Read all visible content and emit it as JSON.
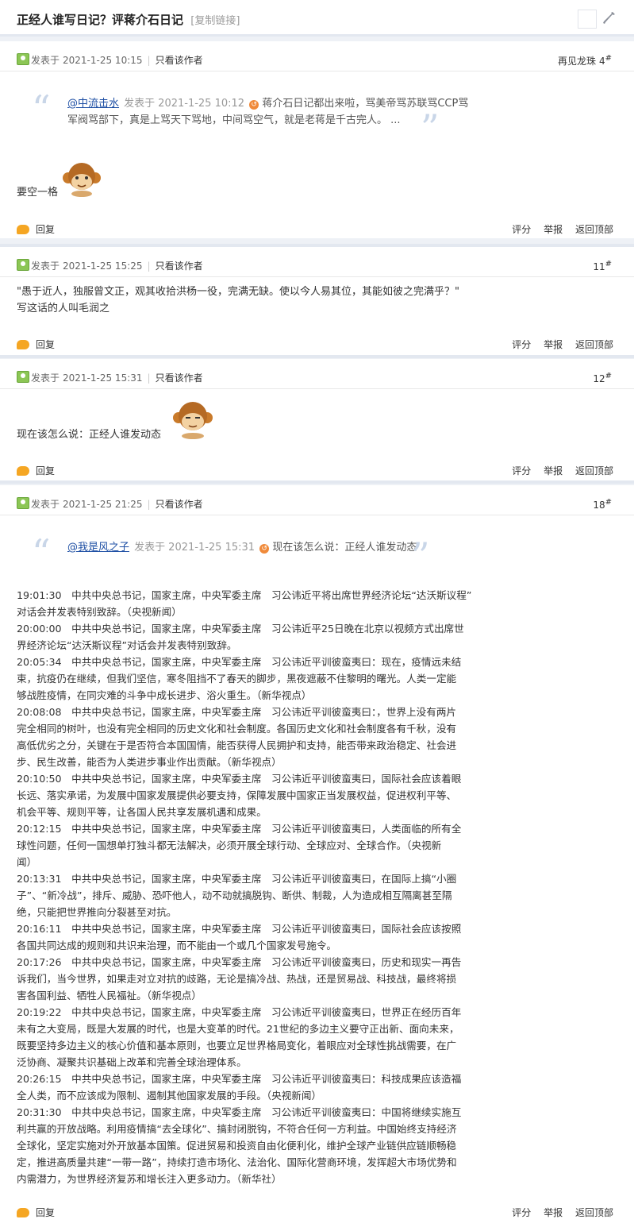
{
  "header": {
    "title": "正经人谁写日记？评蒋介石日记",
    "copy_link": "[复制链接]"
  },
  "posts": [
    {
      "posted_label": "发表于",
      "time": "2021-1-25 10:15",
      "only_author": "只看该作者",
      "nickname": "再见龙珠",
      "floor": "4",
      "floor_mark": "#",
      "quote": {
        "user": "@中流击水",
        "posted_label": "发表于",
        "time": "2021-1-25 10:12",
        "text": "蒋介石日记都出来啦，骂美帝骂苏联骂CCP骂军阀骂部下，真是上骂天下骂地，中间骂空气，就是老蒋是千古完人。 ..."
      },
      "body": "要空一格",
      "emoji": "monkey-emoji"
    },
    {
      "posted_label": "发表于",
      "time": "2021-1-25 15:25",
      "only_author": "只看该作者",
      "floor": "11",
      "floor_mark": "#",
      "body_lines": [
        "\"愚于近人，独服曾文正，观其收拾洪杨一役，完满无缺。使以今人易其位，其能如彼之完满乎？\"",
        "写这话的人叫毛润之"
      ]
    },
    {
      "posted_label": "发表于",
      "time": "2021-1-25 15:31",
      "only_author": "只看该作者",
      "floor": "12",
      "floor_mark": "#",
      "body": "现在该怎么说：正经人谁发动态",
      "emoji": "monkey-emoji"
    },
    {
      "posted_label": "发表于",
      "time": "2021-1-25 21:25",
      "only_author": "只看该作者",
      "floor": "18",
      "floor_mark": "#",
      "quote": {
        "user": "@我是风之子",
        "posted_label": "发表于",
        "time": "2021-1-25 15:31",
        "text": "现在该怎么说：正经人谁发动态"
      },
      "body_lines": [
        "19:01:30　中共中央总书记，国家主席，中央军委主席　习公讳近平将出席世界经济论坛“达沃斯议程”",
        "对话会并发表特别致辞。（央视新闻）",
        "20:00:00　中共中央总书记，国家主席，中央军委主席　习公讳近平25日晚在北京以视频方式出席世",
        "界经济论坛“达沃斯议程”对话会并发表特别致辞。",
        "20:05:34　中共中央总书记，国家主席，中央军委主席　习公讳近平训彼蛮夷曰：现在，疫情远未结",
        "束，抗疫仍在继续，但我们坚信，寒冬阻挡不了春天的脚步，黑夜遮蔽不住黎明的曙光。人类一定能",
        "够战胜疫情，在同灾难的斗争中成长进步、浴火重生。（新华视点）",
        "20:08:08　中共中央总书记，国家主席，中央军委主席　习公讳近平训彼蛮夷曰：，世界上没有两片",
        "完全相同的树叶，也没有完全相同的历史文化和社会制度。各国历史文化和社会制度各有千秋，没有",
        "高低优劣之分，关键在于是否符合本国国情，能否获得人民拥护和支持，能否带来政治稳定、社会进",
        "步、民生改善，能否为人类进步事业作出贡献。（新华视点）",
        "20:10:50　中共中央总书记，国家主席，中央军委主席　习公讳近平训彼蛮夷曰，国际社会应该着眼",
        "长远、落实承诺，为发展中国家发展提供必要支持，保障发展中国家正当发展权益，促进权利平等、",
        "机会平等、规则平等，让各国人民共享发展机遇和成果。",
        "20:12:15　中共中央总书记，国家主席，中央军委主席　习公讳近平训彼蛮夷曰，人类面临的所有全",
        "球性问题，任何一国想单打独斗都无法解决，必须开展全球行动、全球应对、全球合作。（央视新",
        "闻）",
        "20:13:31　中共中央总书记，国家主席，中央军委主席　习公讳近平训彼蛮夷曰，在国际上搞“小圈",
        "子”、“新冷战”，排斥、威胁、恐吓他人，动不动就搞脱钩、断供、制裁，人为造成相互隔离甚至隔",
        "绝，只能把世界推向分裂甚至对抗。",
        "20:16:11　中共中央总书记，国家主席，中央军委主席　习公讳近平训彼蛮夷曰，国际社会应该按照",
        "各国共同达成的规则和共识来治理，而不能由一个或几个国家发号施令。",
        "20:17:26　中共中央总书记，国家主席，中央军委主席　习公讳近平训彼蛮夷曰，历史和现实一再告",
        "诉我们，当今世界，如果走对立对抗的歧路，无论是搞冷战、热战，还是贸易战、科技战，最终将损",
        "害各国利益、牺牲人民福祉。（新华视点）",
        "20:19:22　中共中央总书记，国家主席，中央军委主席　习公讳近平训彼蛮夷曰，世界正在经历百年",
        "未有之大变局，既是大发展的时代，也是大变革的时代。21世纪的多边主义要守正出新、面向未来，",
        "既要坚持多边主义的核心价值和基本原则，也要立足世界格局变化，着眼应对全球性挑战需要，在广",
        "泛协商、凝聚共识基础上改革和完善全球治理体系。",
        "20:26:15　中共中央总书记，国家主席，中央军委主席　习公讳近平训彼蛮夷曰：科技成果应该造福",
        "全人类，而不应该成为限制、遏制其他国家发展的手段。（央视新闻）",
        "20:31:30　中共中央总书记，国家主席，中央军委主席　习公讳近平训彼蛮夷曰：中国将继续实施互",
        "利共赢的开放战略。利用疫情搞“去全球化”、搞封闭脱钩，不符合任何一方利益。中国始终支持经济",
        "全球化，坚定实施对外开放基本国策。促进贸易和投资自由化便利化，维护全球产业链供应链顺畅稳",
        "定，推进高质量共建“一带一路”，持续打造市场化、法治化、国际化营商环境，发挥超大市场优势和",
        "内需潜力，为世界经济复苏和增长注入更多动力。（新华社）"
      ]
    }
  ],
  "footer": {
    "reply": "回复",
    "rate": "评分",
    "report": "举报",
    "back_top": "返回顶部"
  }
}
